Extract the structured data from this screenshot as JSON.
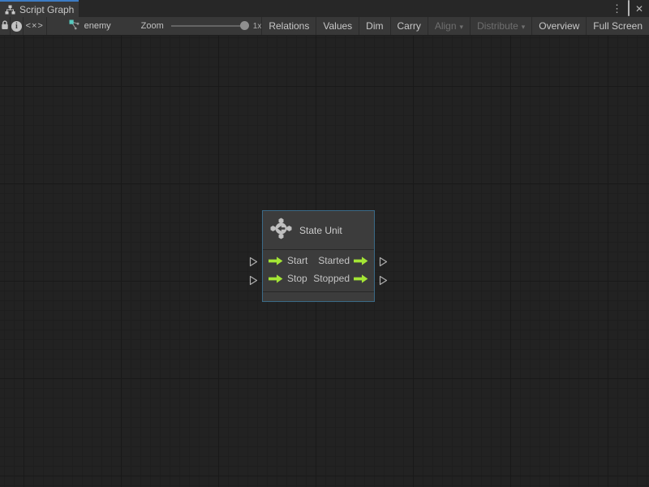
{
  "window": {
    "tab_title": "Script Graph",
    "controls": {
      "menu_icon": "⋮",
      "close_icon": "✕"
    }
  },
  "toolbar": {
    "code_preview_label": "<×>",
    "graph_name": "enemy",
    "zoom_label": "Zoom",
    "zoom_value": "1x",
    "buttons": [
      {
        "label": "Relations",
        "enabled": true
      },
      {
        "label": "Values",
        "enabled": true
      },
      {
        "label": "Dim",
        "enabled": true
      },
      {
        "label": "Carry",
        "enabled": true
      },
      {
        "label": "Align",
        "enabled": false,
        "dropdown": "▾"
      },
      {
        "label": "Distribute",
        "enabled": false,
        "dropdown": "▾"
      },
      {
        "label": "Overview",
        "enabled": true
      },
      {
        "label": "Full Screen",
        "enabled": true
      }
    ]
  },
  "graph": {
    "node": {
      "title": "State Unit",
      "rows": [
        {
          "input": "Start",
          "output": "Started"
        },
        {
          "input": "Stop",
          "output": "Stopped"
        }
      ]
    }
  },
  "colors": {
    "accent_blue": "#3C7CC4",
    "selection_border": "#3B6A87",
    "port_green": "#A4E535",
    "canvas_bg": "#222222",
    "panel_bg": "#383838"
  }
}
